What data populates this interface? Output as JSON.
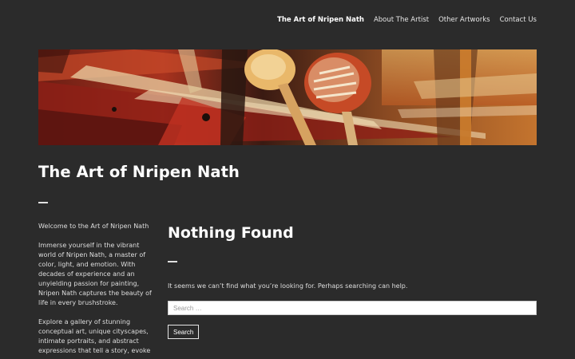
{
  "nav": {
    "items": [
      {
        "label": "The Art of Nripen Nath",
        "current": true
      },
      {
        "label": "About The Artist",
        "current": false
      },
      {
        "label": "Other Artworks",
        "current": false
      },
      {
        "label": "Contact Us",
        "current": false
      }
    ]
  },
  "header": {
    "image": "abstract-painting-banner",
    "site_title": "The Art of Nripen Nath"
  },
  "sidebar": {
    "paragraphs": [
      "Welcome to the Art of Nripen Nath",
      "Immerse yourself in the vibrant world of Nripen Nath, a master of color, light, and emotion. With decades of experience and an unyielding passion for painting, Nripen Nath captures the beauty of life in every brushstroke.",
      "Explore a gallery of stunning conceptual art, unique cityscapes, intimate portraits, and abstract expressions that tell a story, evoke"
    ]
  },
  "main": {
    "heading": "Nothing Found",
    "message": "It seems we can’t find what you’re looking for. Perhaps searching can help.",
    "search": {
      "placeholder": "Search …",
      "value": "",
      "button_label": "Search"
    }
  },
  "colors": {
    "background": "#2b2b2b",
    "text": "#e8e8e8",
    "heading": "#ffffff"
  }
}
